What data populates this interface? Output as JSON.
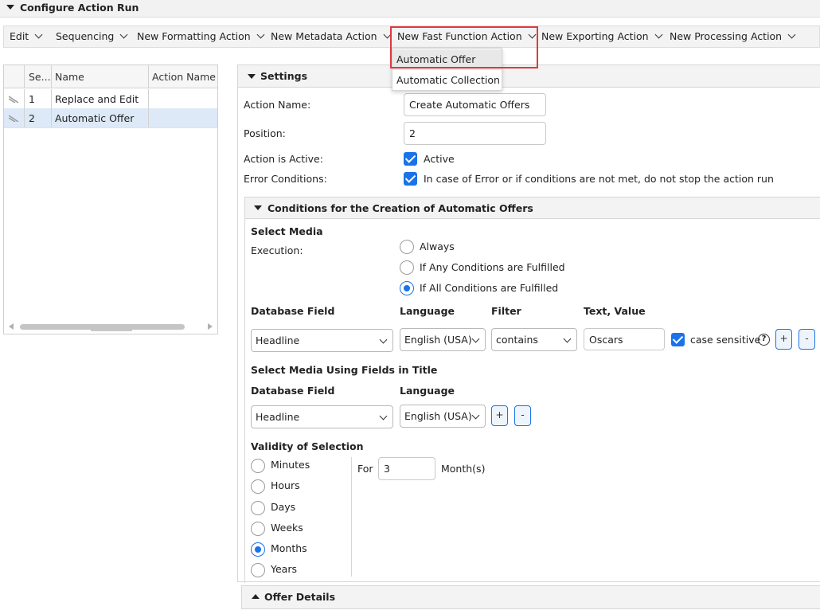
{
  "window": {
    "title": "Configure Action Run"
  },
  "menubar": {
    "items": [
      {
        "label": "Edit"
      },
      {
        "label": "Sequencing"
      },
      {
        "label": "New Formatting Action"
      },
      {
        "label": "New Metadata Action"
      },
      {
        "label": "New Fast Function Action"
      },
      {
        "label": "New Exporting Action"
      },
      {
        "label": "New Processing Action"
      }
    ]
  },
  "dropdown": {
    "items": [
      {
        "label": "Automatic Offer",
        "highlighted": true
      },
      {
        "label": "Automatic Collection"
      }
    ]
  },
  "grid": {
    "columns": [
      "Se...",
      "Name",
      "Action Name"
    ],
    "rows": [
      {
        "seq": "1",
        "name": "Replace and Edit",
        "action_name": "",
        "selected": false
      },
      {
        "seq": "2",
        "name": "Automatic Offer",
        "action_name": "",
        "selected": true
      }
    ]
  },
  "settings": {
    "title": "Settings",
    "action_name_label": "Action Name:",
    "action_name_value": "Create Automatic Offers",
    "position_label": "Position:",
    "position_value": "2",
    "active_label": "Action is Active:",
    "active_text": "Active",
    "active_checked": true,
    "error_label": "Error Conditions:",
    "error_text": "In case of Error or if conditions are not met, do not stop the action run",
    "error_checked": true
  },
  "conditions": {
    "title": "Conditions for the Creation of Automatic Offers",
    "select_media_heading": "Select Media",
    "execution_label": "Execution:",
    "execution_options": [
      {
        "label": "Always",
        "selected": false
      },
      {
        "label": "If Any Conditions are Fulfilled",
        "selected": false
      },
      {
        "label": "If All Conditions are Fulfilled",
        "selected": true
      }
    ],
    "headers": {
      "database_field": "Database Field",
      "language": "Language",
      "filter": "Filter",
      "text_value": "Text, Value"
    },
    "row": {
      "database_field": "Headline",
      "language": "English (USA)",
      "filter": "contains",
      "text_value": "Oscars",
      "case_sensitive_label": "case sensitive",
      "case_sensitive": true
    },
    "help_glyph": "?",
    "add_label": "+",
    "remove_label": "-",
    "title_fields_heading": "Select Media Using Fields in Title",
    "title_headers": {
      "database_field": "Database Field",
      "language": "Language"
    },
    "title_row": {
      "database_field": "Headline",
      "language": "English (USA)"
    },
    "validity_heading": "Validity of Selection",
    "validity_options": [
      {
        "label": "Minutes",
        "selected": false
      },
      {
        "label": "Hours",
        "selected": false
      },
      {
        "label": "Days",
        "selected": false
      },
      {
        "label": "Weeks",
        "selected": false
      },
      {
        "label": "Months",
        "selected": true
      },
      {
        "label": "Years",
        "selected": false
      }
    ],
    "for_label": "For",
    "for_value": "3",
    "unit_label": "Month(s)"
  },
  "offer_details": {
    "title": "Offer Details"
  },
  "colors": {
    "accent": "#1a73e8",
    "highlight_border": "#e0393e",
    "selected_row": "#dde9f7"
  }
}
